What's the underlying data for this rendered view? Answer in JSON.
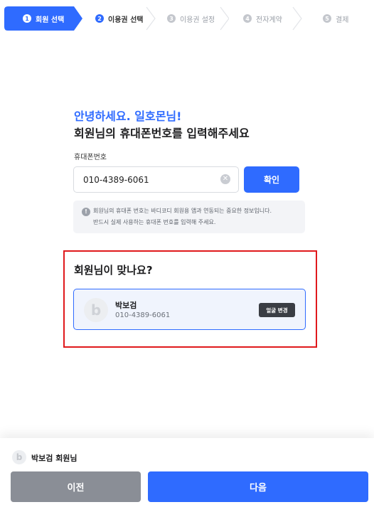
{
  "stepper": {
    "steps": [
      {
        "num": "1",
        "label": "회원 선택"
      },
      {
        "num": "2",
        "label": "이용권 선택"
      },
      {
        "num": "3",
        "label": "이용권 설정"
      },
      {
        "num": "4",
        "label": "전자계약"
      },
      {
        "num": "5",
        "label": "결제"
      }
    ],
    "active_color": "#2F6BFF"
  },
  "lookup": {
    "greeting": "안녕하세요. 일호몬님!",
    "title": "회원님의 휴대폰번호를 입력해주세요",
    "phone_label": "휴대폰번호",
    "phone_value": "010-4389-6061",
    "confirm_label": "확인",
    "notice_line1": "회원님의 휴대폰 번호는 바디코디 회원용 앱과 연동되는 중요한 정보입니다.",
    "notice_line2": "반드시 실제 사용하는 휴대폰 번호를 입력해 주세요."
  },
  "member_confirm": {
    "question": "회원님이 맞나요?",
    "avatar_letter": "b",
    "name": "박보검",
    "phone": "010-4389-6061",
    "face_change_label": "얼굴 변경"
  },
  "footer": {
    "avatar_letter": "b",
    "member_label": "박보검 회원님",
    "prev_label": "이전",
    "next_label": "다음"
  },
  "colors": {
    "primary": "#2F6BFF",
    "highlight_border": "#E0191C",
    "prev_button": "#8A8E96"
  }
}
